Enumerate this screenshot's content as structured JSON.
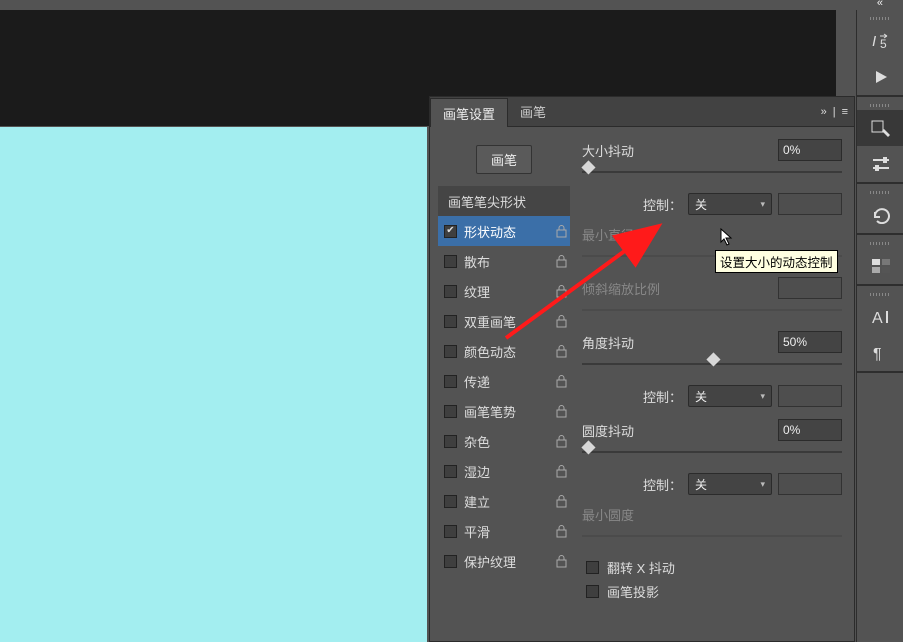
{
  "top_collapse": "«",
  "panel": {
    "tabs": {
      "active": "画笔设置",
      "other": "画笔"
    },
    "expand": "»",
    "brush_btn": "画笔",
    "left": {
      "tip_shape": "画笔笔尖形状",
      "items": [
        {
          "label": "形状动态",
          "checked": true,
          "active": true
        },
        {
          "label": "散布",
          "checked": false
        },
        {
          "label": "纹理",
          "checked": false
        },
        {
          "label": "双重画笔",
          "checked": false
        },
        {
          "label": "颜色动态",
          "checked": false
        },
        {
          "label": "传递",
          "checked": false
        },
        {
          "label": "画笔笔势",
          "checked": false
        },
        {
          "label": "杂色",
          "checked": false
        },
        {
          "label": "湿边",
          "checked": false
        },
        {
          "label": "建立",
          "checked": false
        },
        {
          "label": "平滑",
          "checked": false
        },
        {
          "label": "保护纹理",
          "checked": false
        }
      ]
    },
    "right": {
      "size_jitter": {
        "label": "大小抖动",
        "value": "0%"
      },
      "control_label": "控制：",
      "control_off": "关",
      "min_diam": "最小直径",
      "tilt_scale": "倾斜缩放比例",
      "angle_jitter": {
        "label": "角度抖动",
        "value": "50%"
      },
      "round_jitter": {
        "label": "圆度抖动",
        "value": "0%"
      },
      "min_round": "最小圆度",
      "flip_x": "翻转 X 抖动",
      "brush_proj": "画笔投影"
    }
  },
  "tooltip": "设置大小的动态控制"
}
